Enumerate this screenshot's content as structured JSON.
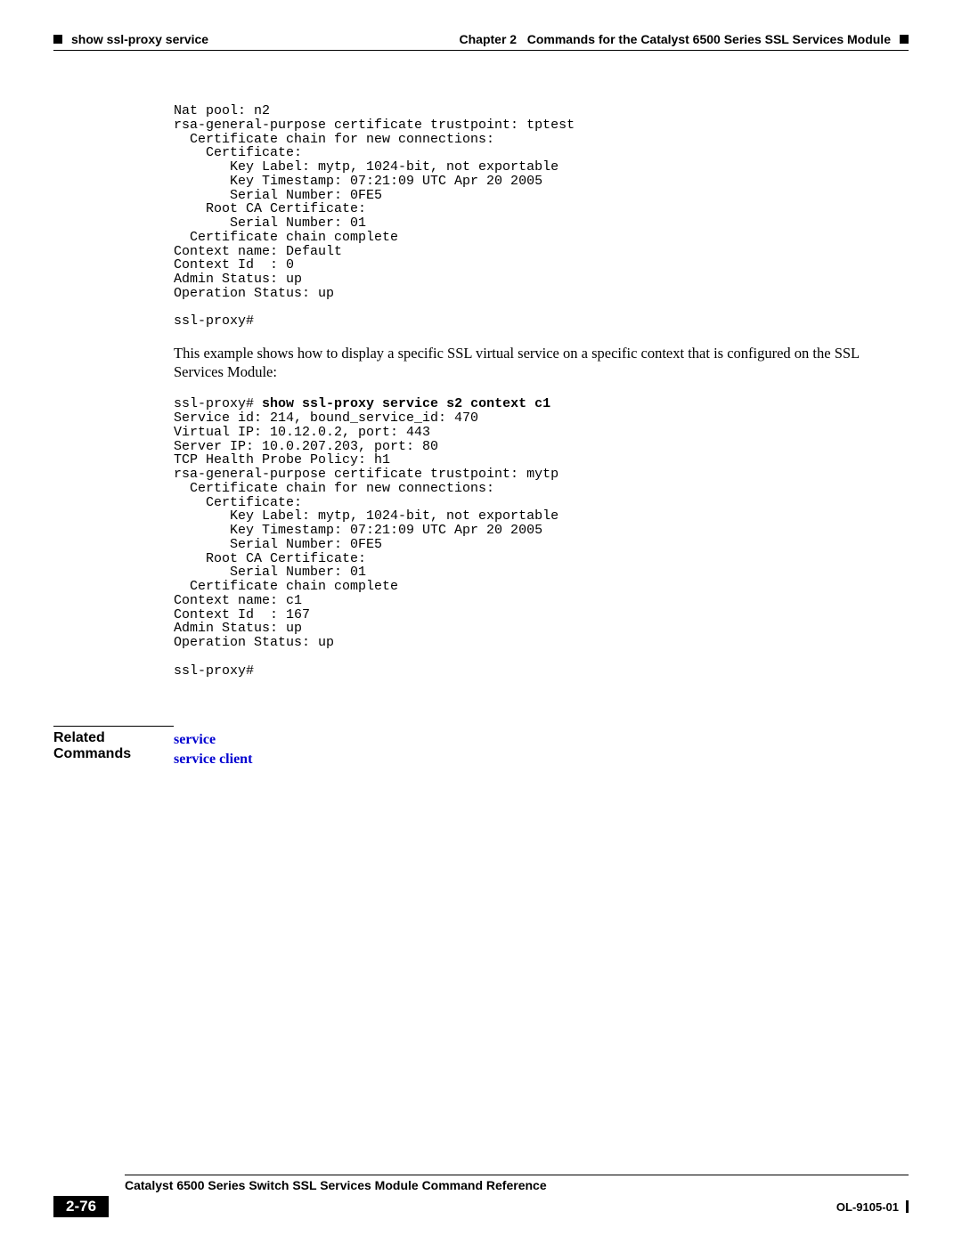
{
  "header": {
    "chapter_label": "Chapter 2",
    "chapter_title": "Commands for the Catalyst 6500 Series SSL Services Module",
    "section_title": "show ssl-proxy service"
  },
  "code_block_1": "Nat pool: n2\nrsa-general-purpose certificate trustpoint: tptest\n  Certificate chain for new connections:\n    Certificate:\n       Key Label: mytp, 1024-bit, not exportable\n       Key Timestamp: 07:21:09 UTC Apr 20 2005\n       Serial Number: 0FE5\n    Root CA Certificate:\n       Serial Number: 01\n  Certificate chain complete\nContext name: Default\nContext Id  : 0\nAdmin Status: up\nOperation Status: up\n\nssl-proxy#",
  "paragraph_1": "This example shows how to display a specific SSL virtual service on a specific context that is configured on the SSL Services Module:",
  "code_block_2_prompt": "ssl-proxy# ",
  "code_block_2_cmd": "show ssl-proxy service s2 context c1",
  "code_block_2_body": "Service id: 214, bound_service_id: 470\nVirtual IP: 10.12.0.2, port: 443 \nServer IP: 10.0.207.203, port: 80\nTCP Health Probe Policy: h1\nrsa-general-purpose certificate trustpoint: mytp\n  Certificate chain for new connections:\n    Certificate:\n       Key Label: mytp, 1024-bit, not exportable\n       Key Timestamp: 07:21:09 UTC Apr 20 2005\n       Serial Number: 0FE5\n    Root CA Certificate:\n       Serial Number: 01\n  Certificate chain complete\nContext name: c1\nContext Id  : 167\nAdmin Status: up\nOperation Status: up\n\nssl-proxy#",
  "related": {
    "label": "Related Commands",
    "links": [
      "service",
      "service client"
    ]
  },
  "footer": {
    "book_title": "Catalyst 6500 Series Switch SSL Services Module Command Reference",
    "page_number": "2-76",
    "doc_id": "OL-9105-01"
  }
}
